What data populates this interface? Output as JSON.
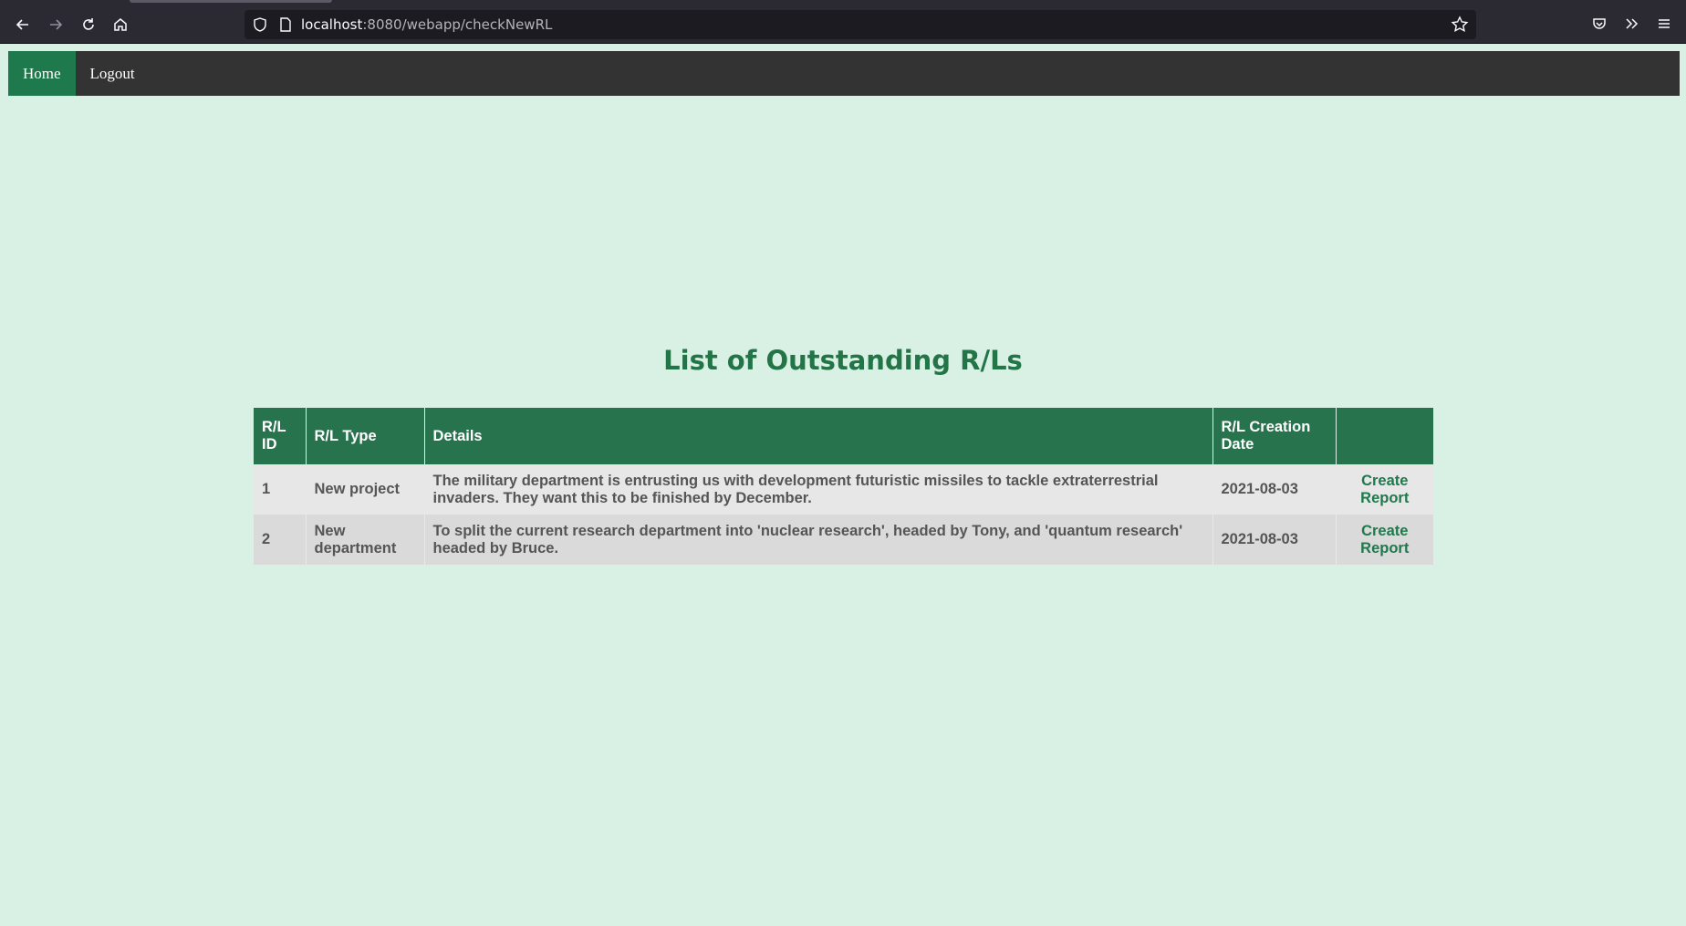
{
  "browser": {
    "url_host": "localhost",
    "url_rest": ":8080/webapp/checkNewRL"
  },
  "nav": {
    "home": "Home",
    "logout": "Logout"
  },
  "page": {
    "title": "List of Outstanding R/Ls"
  },
  "table": {
    "headers": [
      "R/L ID",
      "R/L Type",
      "Details",
      "R/L Creation Date",
      ""
    ],
    "rows": [
      {
        "id": "1",
        "type": "New project",
        "details": "The military department is entrusting us with development futuristic missiles to tackle extraterrestrial invaders. They want this to be finished by December.",
        "date": "2021-08-03",
        "action": "Create Report"
      },
      {
        "id": "2",
        "type": "New department",
        "details": "To split the current research department into 'nuclear research', headed by Tony, and 'quantum research' headed by Bruce.",
        "date": "2021-08-03",
        "action": "Create Report"
      }
    ]
  },
  "colors": {
    "page_bg": "#d8f1e4",
    "accent": "#27734d",
    "navbar": "#333333"
  }
}
